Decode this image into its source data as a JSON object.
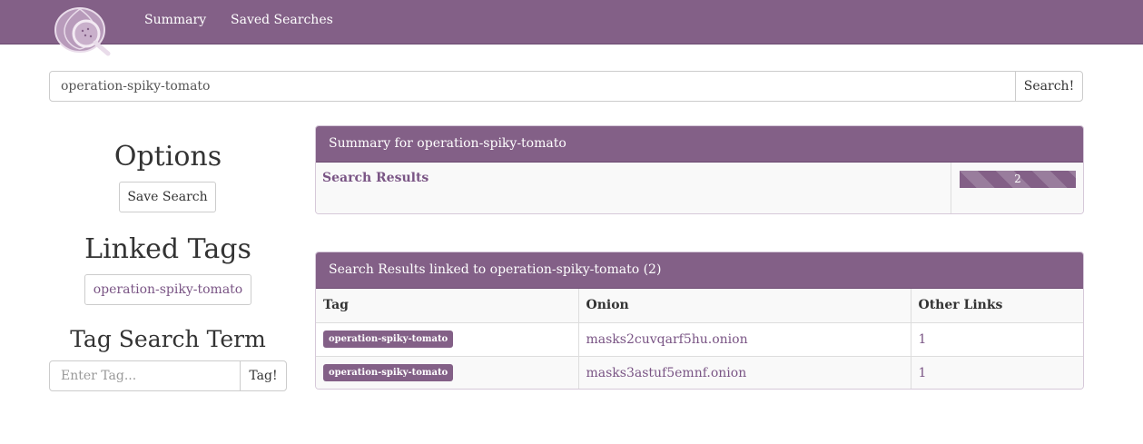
{
  "nav": {
    "summary": "Summary",
    "saved_searches": "Saved Searches"
  },
  "search": {
    "value": "operation-spiky-tomato",
    "button": "Search!"
  },
  "sidebar": {
    "options_heading": "Options",
    "save_search": "Save Search",
    "linked_tags_heading": "Linked Tags",
    "linked_tags": [
      "operation-spiky-tomato"
    ],
    "tag_search_heading": "Tag Search Term",
    "tag_placeholder": "Enter Tag...",
    "tag_button": "Tag!"
  },
  "summary_panel": {
    "title": "Summary for operation-spiky-tomato",
    "row_label": "Search Results",
    "count": "2",
    "progress_fraction": 1.0
  },
  "results_panel": {
    "title": "Search Results linked to operation-spiky-tomato (2)",
    "columns": [
      "Tag",
      "Onion",
      "Other Links"
    ],
    "rows": [
      {
        "tag": "operation-spiky-tomato",
        "onion": "masks2cuvqarf5hu.onion",
        "other_links": "1"
      },
      {
        "tag": "operation-spiky-tomato",
        "onion": "masks3astuf5emnf.onion",
        "other_links": "1"
      }
    ]
  },
  "colors": {
    "brand": "#836087",
    "link": "#7a5585"
  },
  "icons": {
    "logo": "onion-magnifier-logo"
  }
}
